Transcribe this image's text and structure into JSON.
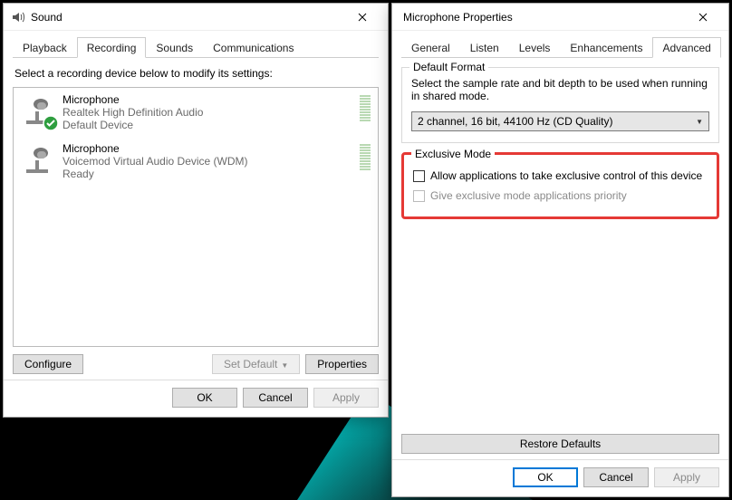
{
  "sound": {
    "title": "Sound",
    "tabs": [
      "Playback",
      "Recording",
      "Sounds",
      "Communications"
    ],
    "active_tab": 1,
    "instruction": "Select a recording device below to modify its settings:",
    "devices": [
      {
        "name": "Microphone",
        "sub": "Realtek High Definition Audio",
        "status": "Default Device",
        "default": true
      },
      {
        "name": "Microphone",
        "sub": "Voicemod Virtual Audio Device (WDM)",
        "status": "Ready",
        "default": false
      }
    ],
    "buttons": {
      "configure": "Configure",
      "set_default": "Set Default",
      "properties": "Properties",
      "ok": "OK",
      "cancel": "Cancel",
      "apply": "Apply"
    }
  },
  "mic": {
    "title": "Microphone Properties",
    "tabs": [
      "General",
      "Listen",
      "Levels",
      "Enhancements",
      "Advanced"
    ],
    "active_tab": 4,
    "default_format": {
      "title": "Default Format",
      "desc": "Select the sample rate and bit depth to be used when running in shared mode.",
      "value": "2 channel, 16 bit, 44100 Hz (CD Quality)"
    },
    "exclusive": {
      "title": "Exclusive Mode",
      "opt1": "Allow applications to take exclusive control of this device",
      "opt2": "Give exclusive mode applications priority"
    },
    "restore": "Restore Defaults",
    "buttons": {
      "ok": "OK",
      "cancel": "Cancel",
      "apply": "Apply"
    }
  }
}
